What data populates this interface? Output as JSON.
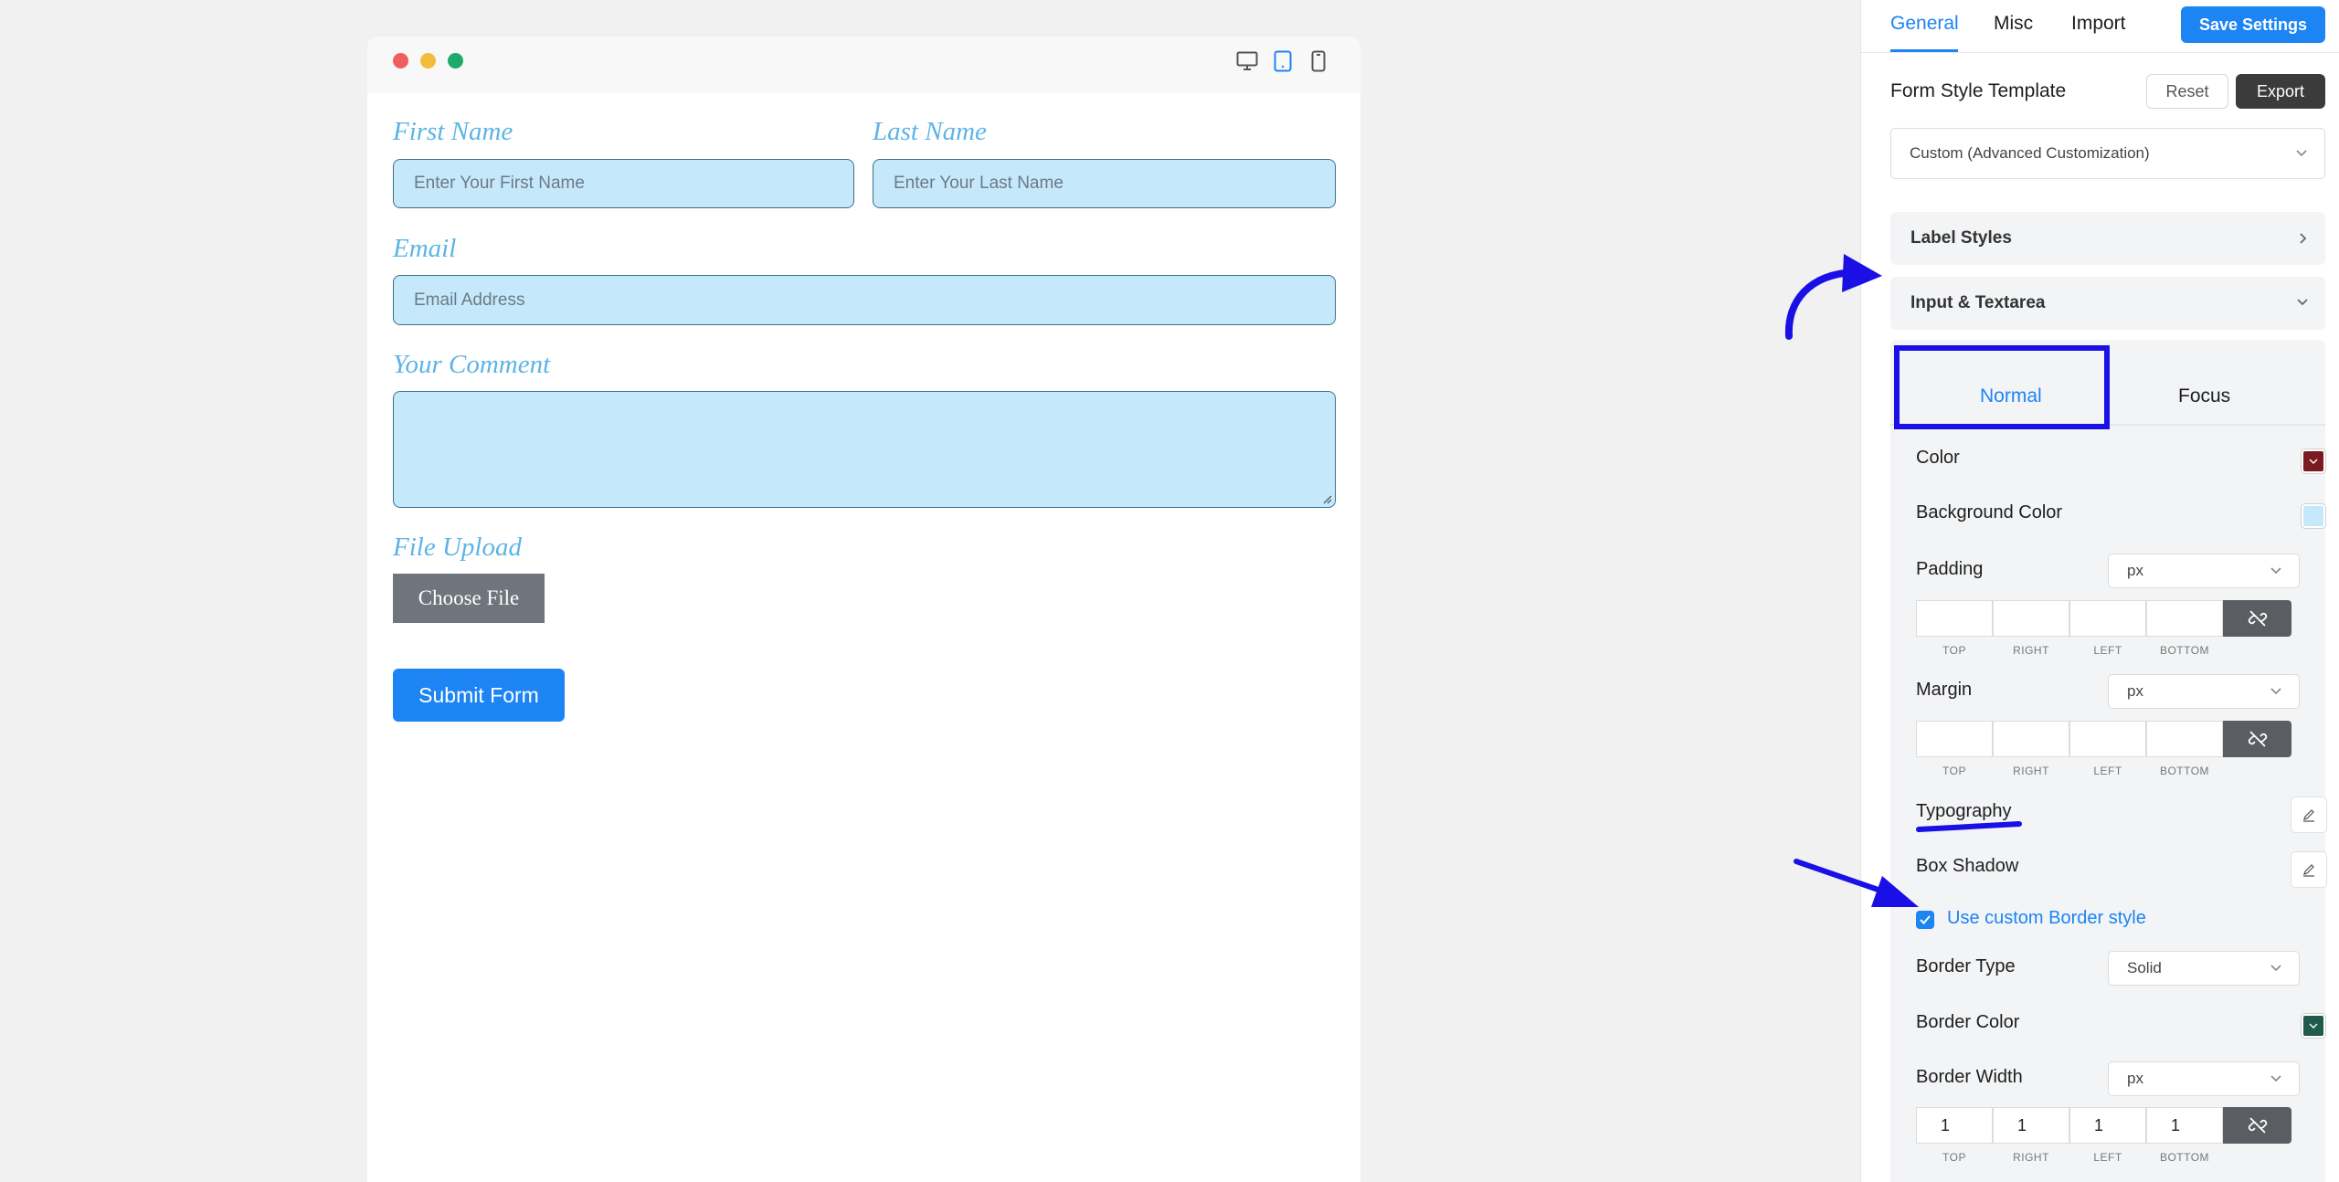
{
  "preview": {
    "devices": [
      "desktop-icon",
      "tablet-icon",
      "mobile-icon"
    ],
    "active_device": "tablet",
    "form": {
      "first_name_label": "First Name",
      "first_name_placeholder": "Enter Your First Name",
      "last_name_label": "Last Name",
      "last_name_placeholder": "Enter Your Last Name",
      "email_label": "Email",
      "email_placeholder": "Email Address",
      "comment_label": "Your Comment",
      "file_upload_label": "File Upload",
      "choose_file_label": "Choose File",
      "submit_label": "Submit Form"
    }
  },
  "sidebar": {
    "tabs": [
      {
        "label": "General",
        "active": true
      },
      {
        "label": "Misc",
        "active": false
      },
      {
        "label": "Import",
        "active": false
      }
    ],
    "save_label": "Save Settings",
    "template_title": "Form Style Template",
    "reset_label": "Reset",
    "export_label": "Export",
    "template_value": "Custom (Advanced Customization)",
    "label_styles": "Label Styles",
    "input_textarea": "Input & Textarea",
    "inner_tabs": {
      "normal": "Normal",
      "focus": "Focus"
    },
    "color_label": "Color",
    "color_value": "#7a1a22",
    "bg_color_label": "Background Color",
    "bg_color_value": "#c5e9fb",
    "padding_label": "Padding",
    "padding_unit": "px",
    "padding_values": {
      "top": "",
      "right": "",
      "left": "",
      "bottom": ""
    },
    "margin_label": "Margin",
    "margin_unit": "px",
    "margin_values": {
      "top": "",
      "right": "",
      "left": "",
      "bottom": ""
    },
    "dim_captions": {
      "top": "TOP",
      "right": "RIGHT",
      "left": "LEFT",
      "bottom": "BOTTOM"
    },
    "typography_label": "Typography",
    "box_shadow_label": "Box Shadow",
    "custom_border_label": "Use custom Border style",
    "custom_border_checked": true,
    "border_type_label": "Border Type",
    "border_type_value": "Solid",
    "border_color_label": "Border Color",
    "border_color_value": "#1f5a4c",
    "border_width_label": "Border Width",
    "border_width_unit": "px",
    "border_width_values": {
      "top": "1",
      "right": "1",
      "left": "1",
      "bottom": "1"
    }
  },
  "colors": {
    "accent": "#1c84f3",
    "annotation": "#1a10e6",
    "input_bg": "#c5e9fb",
    "label": "#5cb4e6"
  }
}
